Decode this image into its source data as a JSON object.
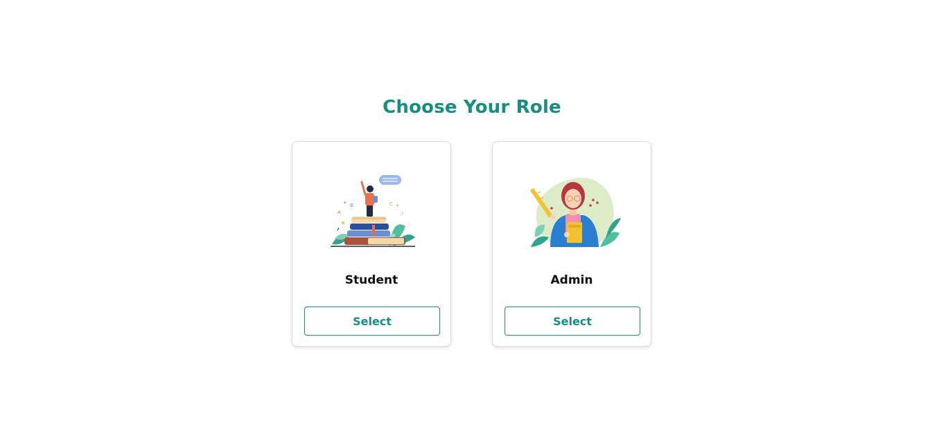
{
  "page": {
    "title": "Choose Your Role"
  },
  "roles": [
    {
      "name": "Student",
      "button_label": "Select",
      "illustration": "student-books-illustration"
    },
    {
      "name": "Admin",
      "button_label": "Select",
      "illustration": "teacher-with-book-illustration"
    }
  ],
  "colors": {
    "accent": "#168f82",
    "card_border": "#dcdcdc",
    "text": "#111111"
  }
}
